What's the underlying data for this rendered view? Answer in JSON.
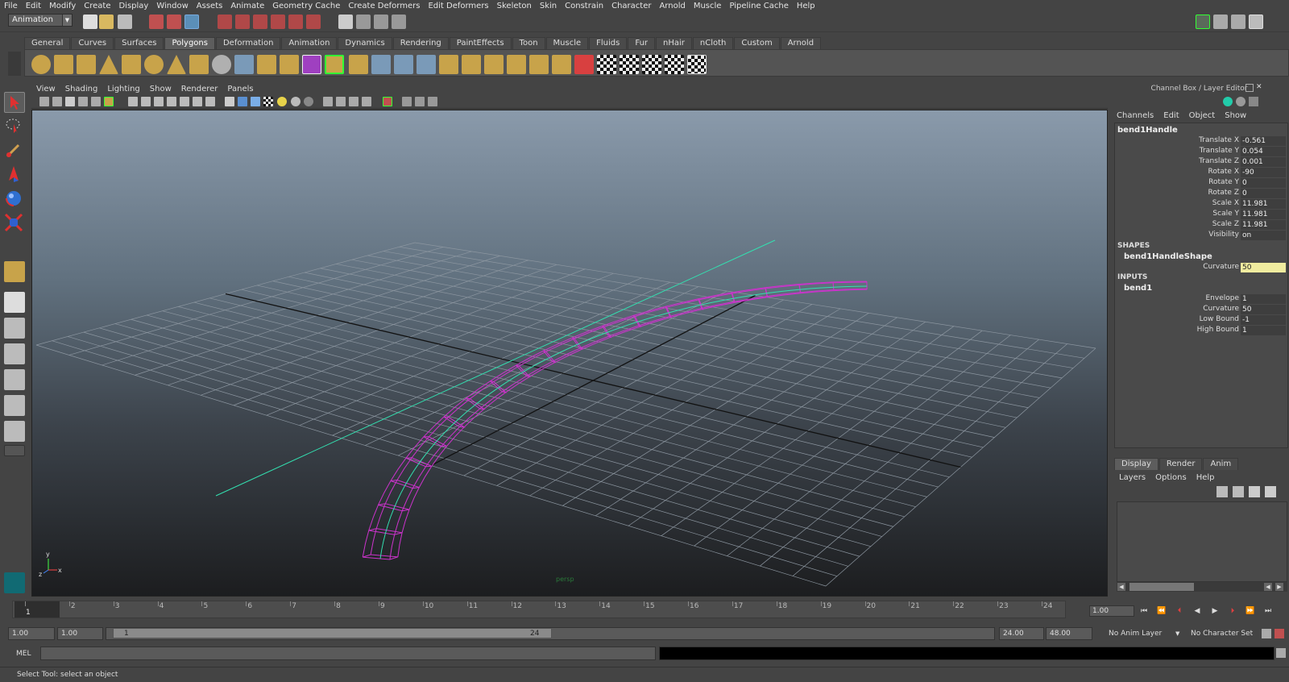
{
  "menubar": [
    "File",
    "Edit",
    "Modify",
    "Create",
    "Display",
    "Window",
    "Assets",
    "Animate",
    "Geometry Cache",
    "Create Deformers",
    "Edit Deformers",
    "Skeleton",
    "Skin",
    "Constrain",
    "Character",
    "Arnold",
    "Muscle",
    "Pipeline Cache",
    "Help"
  ],
  "mode_menu": "Animation",
  "shelf_tabs": [
    "General",
    "Curves",
    "Surfaces",
    "Polygons",
    "Deformation",
    "Animation",
    "Dynamics",
    "Rendering",
    "PaintEffects",
    "Toon",
    "Muscle",
    "Fluids",
    "Fur",
    "nHair",
    "nCloth",
    "Custom",
    "Arnold"
  ],
  "shelf_active": "Polygons",
  "viewport_menu": [
    "View",
    "Shading",
    "Lighting",
    "Show",
    "Renderer",
    "Panels"
  ],
  "viewport_camera_label": "persp",
  "axis": {
    "x": "x",
    "y": "y",
    "z": "z"
  },
  "channel_box": {
    "title": "Channel Box / Layer Editor",
    "menu": [
      "Channels",
      "Edit",
      "Object",
      "Show"
    ],
    "node": "bend1Handle",
    "attributes": [
      {
        "name": "Translate X",
        "value": "-0.561"
      },
      {
        "name": "Translate Y",
        "value": "0.054"
      },
      {
        "name": "Translate Z",
        "value": "0.001"
      },
      {
        "name": "Rotate X",
        "value": "-90"
      },
      {
        "name": "Rotate Y",
        "value": "0"
      },
      {
        "name": "Rotate Z",
        "value": "0"
      },
      {
        "name": "Scale X",
        "value": "11.981"
      },
      {
        "name": "Scale Y",
        "value": "11.981"
      },
      {
        "name": "Scale Z",
        "value": "11.981"
      },
      {
        "name": "Visibility",
        "value": "on"
      }
    ],
    "shapes_header": "SHAPES",
    "shape_node": "bend1HandleShape",
    "shape_attributes": [
      {
        "name": "Curvature",
        "value": "50"
      }
    ],
    "inputs_header": "INPUTS",
    "input_node": "bend1",
    "input_attributes": [
      {
        "name": "Envelope",
        "value": "1"
      },
      {
        "name": "Curvature",
        "value": "50"
      },
      {
        "name": "Low Bound",
        "value": "-1"
      },
      {
        "name": "High Bound",
        "value": "1"
      }
    ]
  },
  "layer_editor": {
    "tabs": [
      "Display",
      "Render",
      "Anim"
    ],
    "active_tab": "Display",
    "menu": [
      "Layers",
      "Options",
      "Help"
    ]
  },
  "time_slider": {
    "ticks": [
      "1",
      "2",
      "3",
      "4",
      "5",
      "6",
      "7",
      "8",
      "9",
      "10",
      "11",
      "12",
      "13",
      "14",
      "15",
      "16",
      "17",
      "18",
      "19",
      "20",
      "21",
      "22",
      "23",
      "24"
    ],
    "current_frame_marker": "1",
    "current_frame": "1.00"
  },
  "range_slider": {
    "start_time": "1.00",
    "playback_start": "1.00",
    "range_start_label": "1",
    "range_end_label": "24",
    "playback_end": "24.00",
    "end_time": "48.00",
    "anim_layer": "No Anim Layer",
    "character_set": "No Character Set"
  },
  "command_line": {
    "label": "MEL",
    "value": ""
  },
  "help_line": "Select Tool: select an object",
  "colors": {
    "deformer": "#cc33cc",
    "curve": "#33e0b0",
    "grid": "#8c96a0",
    "axis": "#111111",
    "highlight": "#f0ec9f"
  }
}
